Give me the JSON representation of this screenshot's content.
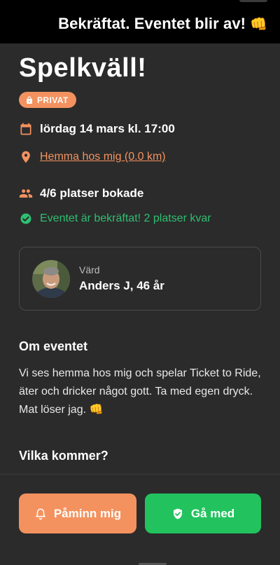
{
  "banner": {
    "text": "Bekräftat. Eventet blir av!",
    "emoji": "👊"
  },
  "event": {
    "title": "Spelkväll!",
    "badge": "PRIVAT",
    "date": "lördag 14 mars kl. 17:00",
    "place": "Hemma hos mig (0.0 km)",
    "spots": "4/6 platser bokade",
    "status": "Eventet är bekräftat! 2 platser kvar"
  },
  "host": {
    "label": "Värd",
    "name": "Anders J, 46 år"
  },
  "about": {
    "title": "Om eventet",
    "text": "Vi ses hemma hos mig och spelar Ticket to Ride, äter och dricker något gott. Ta med egen dryck. Mat löser jag. 👊"
  },
  "who": {
    "title": "Vilka kommer?"
  },
  "actions": {
    "remind": "Påminn mig",
    "join": "Gå med"
  },
  "colors": {
    "accent": "#f4925f",
    "success": "#22c35e",
    "background": "#2b2b2b"
  },
  "icons": {
    "badge": "lock-icon",
    "date": "calendar-icon",
    "place": "location-pin-icon",
    "spots": "people-icon",
    "status": "check-circle-icon",
    "remind": "bell-icon",
    "join": "shield-check-icon"
  }
}
